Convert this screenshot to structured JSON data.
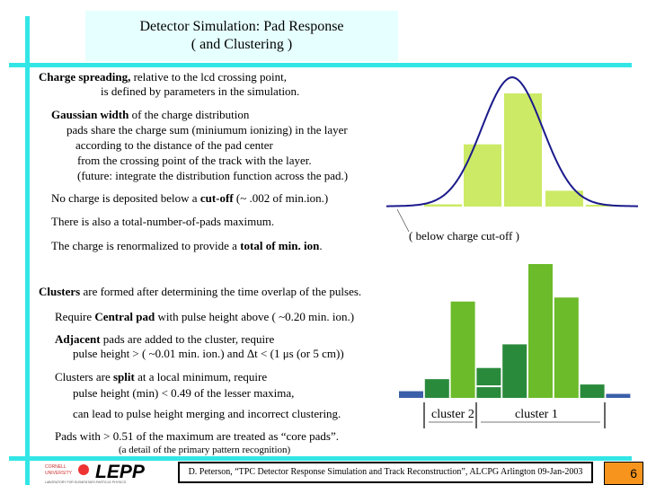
{
  "title": {
    "line1": "Detector Simulation: Pad Response",
    "line2": "( and Clustering )"
  },
  "lines": [
    {
      "segments": [
        {
          "t": "Charge spreading,",
          "b": true
        },
        {
          "t": " relative to the lcd crossing point,",
          "b": false
        }
      ]
    },
    {
      "segments": [
        {
          "t": "is defined by parameters in the simulation.",
          "b": false
        }
      ]
    },
    {
      "segments": [
        {
          "t": "Gaussian width",
          "b": true
        },
        {
          "t": " of the charge distribution",
          "b": false
        }
      ]
    },
    {
      "segments": [
        {
          "t": "pads share the charge sum (miniumum ionizing) in the layer",
          "b": false
        }
      ]
    },
    {
      "segments": [
        {
          "t": "according to the distance of the pad center",
          "b": false
        }
      ]
    },
    {
      "segments": [
        {
          "t": "from the crossing point of the track with the layer.",
          "b": false
        }
      ]
    },
    {
      "segments": [
        {
          "t": "(future: integrate the distribution function across the pad.)",
          "b": false
        }
      ]
    },
    {
      "segments": [
        {
          "t": "No charge is deposited below a ",
          "b": false
        },
        {
          "t": "cut-off",
          "b": true
        },
        {
          "t": " (~ .002 of min.ion.)",
          "b": false
        }
      ]
    },
    {
      "segments": [
        {
          "t": "There is also a total-number-of-pads maximum.",
          "b": false
        }
      ]
    },
    {
      "segments": [
        {
          "t": "The charge is renormalized to provide a ",
          "b": false
        },
        {
          "t": "total of min. ion",
          "b": true
        },
        {
          "t": ".",
          "b": false
        }
      ]
    },
    {
      "segments": [
        {
          "t": "Clusters",
          "b": true
        },
        {
          "t": " are formed after determining the time overlap of the pulses.",
          "b": false
        }
      ]
    },
    {
      "segments": [
        {
          "t": "Require ",
          "b": false
        },
        {
          "t": "Central pad",
          "b": true
        },
        {
          "t": " with  pulse height above ( ~0.20 min. ion.)",
          "b": false
        }
      ]
    },
    {
      "segments": [
        {
          "t": "Adjacent",
          "b": true
        },
        {
          "t": " pads are added to the cluster, require",
          "b": false
        }
      ]
    },
    {
      "segments": [
        {
          "t": "pulse height  > ( ~0.01 min. ion.)   and   Δt  < (1 μs  (or 5 cm))",
          "b": false
        }
      ]
    },
    {
      "segments": [
        {
          "t": "Clusters are ",
          "b": false
        },
        {
          "t": "split",
          "b": true
        },
        {
          "t": " at a local minimum, require",
          "b": false
        }
      ]
    },
    {
      "segments": [
        {
          "t": "pulse height (min) < 0.49 of the lesser maxima,",
          "b": false
        }
      ]
    },
    {
      "segments": [
        {
          "t": "can lead to pulse height merging and incorrect clustering.",
          "b": false
        }
      ]
    },
    {
      "segments": [
        {
          "t": "Pads with > 0.51 of the maximum are treated as “core pads”.",
          "b": false
        }
      ]
    },
    {
      "segments": [
        {
          "t": "(a detail of the  primary pattern recognition)",
          "b": false
        }
      ]
    }
  ],
  "top_figure": {
    "annotation": "( below charge cut-off )",
    "bar_color": "#ccea66",
    "curve_color": "#1a1a8c",
    "bar_values": [
      0.02,
      0.55,
      1.0,
      0.14,
      0.01
    ]
  },
  "bottom_figure": {
    "cluster_labels": [
      "cluster 2",
      "cluster 1"
    ],
    "colors": {
      "light": "#6cbb2a",
      "dark": "#2a8a3c",
      "blue": "#3b5fa8"
    },
    "bars": [
      {
        "v": 0.05,
        "c": "blue"
      },
      {
        "v": 0.14,
        "c": "dark"
      },
      {
        "v": 0.72,
        "c": "light"
      },
      {
        "v": 0.08,
        "c": "dark",
        "stack": 0.13
      },
      {
        "v": 0.4,
        "c": "dark"
      },
      {
        "v": 1.0,
        "c": "light"
      },
      {
        "v": 0.75,
        "c": "light"
      },
      {
        "v": 0.1,
        "c": "dark"
      },
      {
        "v": 0.03,
        "c": "blue"
      }
    ]
  },
  "footer": {
    "logo_text": "LEPP",
    "logo_small1": "CORNELL",
    "logo_small2": "UNIVERSITY",
    "logo_sub": "LABORATORY FOR ELEMENTARY-PARTICLE PHYSICS",
    "citation": "D. Peterson, “TPC Detector Response Simulation and Track Reconstruction”, ALCPG Arlington 09-Jan-2003",
    "page": "6"
  },
  "accent": "#33e6e6"
}
